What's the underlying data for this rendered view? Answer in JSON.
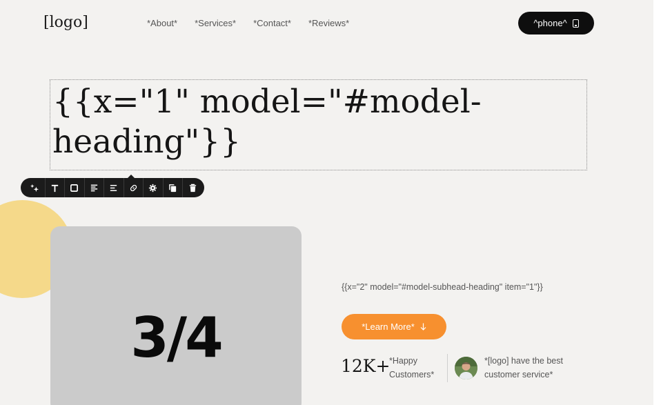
{
  "header": {
    "logo": "[logo]",
    "nav": [
      "*About*",
      "*Services*",
      "*Contact*",
      "*Reviews*"
    ],
    "phone_label": "^phone^",
    "phone_icon": "phone-icon"
  },
  "hero": {
    "heading": "{{x=\"1\" model=\"#model-heading\"}}",
    "media_text": "3/4",
    "subhead": "{{x=\"2\" model=\"#model-subhead-heading\" item=\"1\"}}",
    "cta_label": "*Learn More*",
    "cta_icon": "arrow-down-icon",
    "stat_number": "12K+",
    "stat_label": "*Happy Customers*",
    "testimonial": "*[logo] have the best customer service*"
  },
  "editor_toolbar": {
    "buttons": [
      "ai-magic-icon",
      "text-icon",
      "box-icon",
      "align-left-icon",
      "align-center-icon",
      "link-icon",
      "settings-icon",
      "duplicate-icon",
      "delete-icon"
    ]
  },
  "colors": {
    "accent": "#f7902f",
    "blob": "#f5d98a",
    "dark": "#0e0e0e",
    "background": "#f3f2f0",
    "media_placeholder": "#cbcbcb"
  }
}
